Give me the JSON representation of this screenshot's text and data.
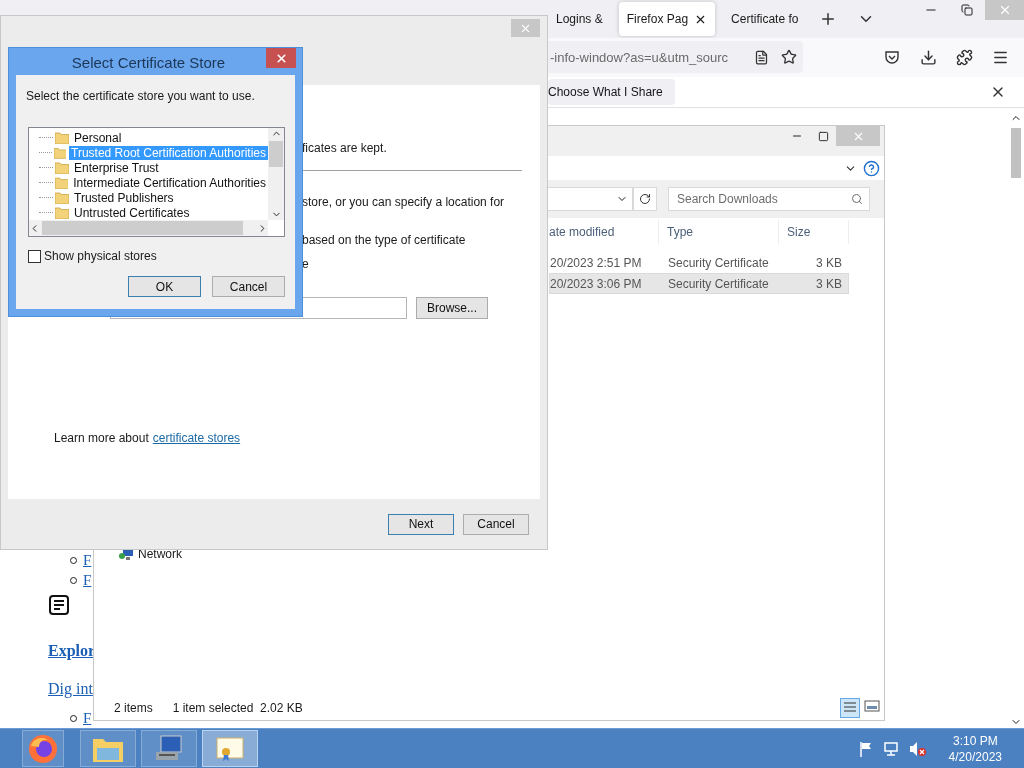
{
  "browser": {
    "tabs": [
      {
        "label": "Logins &",
        "selected": false
      },
      {
        "label": "Firefox Pag",
        "selected": true
      },
      {
        "label": "Certificate fo",
        "selected": false
      }
    ],
    "url": "-info-window?as=u&utm_sourc",
    "notification_button": "Choose What I Share"
  },
  "page": {
    "items": [
      {
        "kind": "bullet",
        "text": "F"
      },
      {
        "kind": "bullet",
        "text": "F"
      },
      {
        "kind": "icon"
      },
      {
        "kind": "heading",
        "text": "Explor"
      },
      {
        "kind": "link",
        "text": "Dig int"
      },
      {
        "kind": "bullet",
        "text": "F"
      }
    ]
  },
  "explorer": {
    "search": {
      "placeholder": "Search Downloads"
    },
    "nav_items": [
      {
        "label": "Network"
      }
    ],
    "columns": [
      "ate modified",
      "Type",
      "Size"
    ],
    "rows": [
      {
        "date": "20/2023 2:51 PM",
        "type": "Security Certificate",
        "size": "3 KB",
        "selected": false
      },
      {
        "date": "20/2023 3:06 PM",
        "type": "Security Certificate",
        "size": "3 KB",
        "selected": true
      }
    ],
    "status": {
      "count": "2 items",
      "selection": "1 item selected  2.02 KB"
    }
  },
  "wizard": {
    "texts": [
      "ficates are kept.",
      "store, or you can specify a location for",
      "based on the type of certificate",
      "e"
    ],
    "browse_button": "Browse...",
    "link_prefix": "Learn more about",
    "link": "certificate stores",
    "buttons": [
      {
        "label": "Next",
        "default": true
      },
      {
        "label": "Cancel",
        "default": false
      }
    ]
  },
  "dialog": {
    "title": "Select Certificate Store",
    "prompt": "Select the certificate store you want to use.",
    "stores": [
      {
        "label": "Personal",
        "selected": false
      },
      {
        "label": "Trusted Root Certification Authorities",
        "selected": true
      },
      {
        "label": "Enterprise Trust",
        "selected": false
      },
      {
        "label": "Intermediate Certification Authorities",
        "selected": false
      },
      {
        "label": "Trusted Publishers",
        "selected": false
      },
      {
        "label": "Untrusted Certificates",
        "selected": false
      }
    ],
    "show_physical": {
      "label": "Show physical stores",
      "checked": false
    },
    "buttons": [
      {
        "label": "OK",
        "default": true
      },
      {
        "label": "Cancel",
        "default": false
      }
    ]
  },
  "taskbar": {
    "apps": [
      {
        "kind": "firefox",
        "selected": false
      },
      {
        "kind": "explorer",
        "selected": false
      },
      {
        "kind": "computer",
        "selected": false
      },
      {
        "kind": "certificate",
        "selected": true
      }
    ],
    "time": "3:10 PM",
    "date": "4/20/2023"
  }
}
